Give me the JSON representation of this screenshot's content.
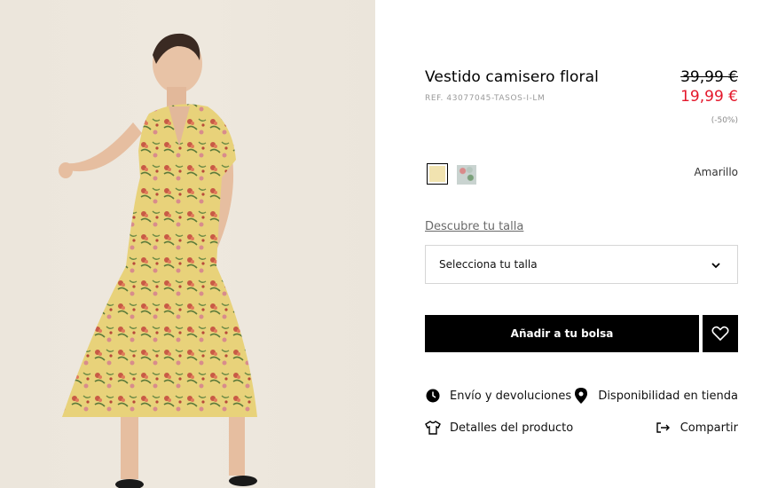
{
  "product": {
    "title": "Vestido camisero floral",
    "ref": "REF. 43077045-TASOS-I-LM",
    "price_old": "39,99 €",
    "price_new": "19,99 €",
    "discount": "(-50%)",
    "price_new_color": "#e4172b"
  },
  "colors": {
    "selected_label": "Amarillo",
    "swatches": [
      {
        "name": "yellow",
        "hex": "#f1e3b0"
      },
      {
        "name": "print",
        "hex": "#c9d3d0"
      }
    ]
  },
  "size": {
    "guide_link": "Descubre tu talla",
    "select_placeholder": "Selecciona tu talla"
  },
  "actions": {
    "add_to_bag": "Añadir a tu bolsa"
  },
  "info_links": {
    "shipping": "Envío y devoluciones",
    "store_availability": "Disponibilidad en tienda",
    "product_details": "Detalles del producto",
    "share": "Compartir"
  }
}
